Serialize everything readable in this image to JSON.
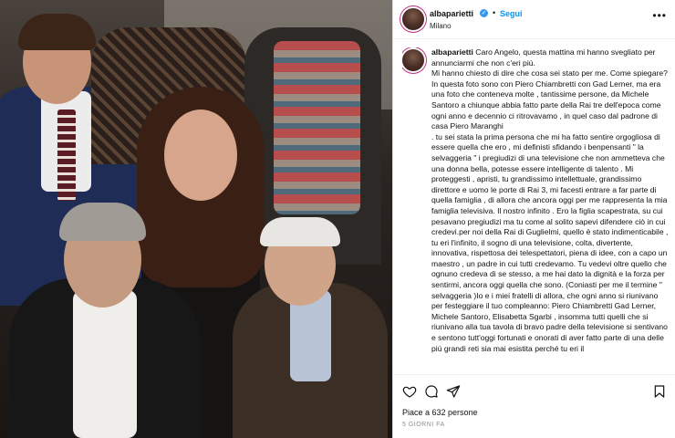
{
  "post": {
    "username": "albaparietti",
    "verified_icon": "✓",
    "dot": "•",
    "follow_label": "Segui",
    "location": "Milano",
    "more_icon": "•••"
  },
  "caption": {
    "username": "albaparietti",
    "text": " Caro Angelo, questa mattina mi hanno svegliato per annunciarmi che non c'eri più.\nMi hanno chiesto di dire che cosa sei stato per me. Come spiegare?\nIn questa foto sono con Piero Chiambretti con Gad Lerner, ma era una foto che conteneva molte , tantissime persone, da Michele Santoro a chiunque abbia fatto parte della Rai tre dell'epoca come ogni anno e decennio ci ritrovavamo , in quel caso dal padrone di casa Piero Maranghi\n. tu sei stata la prima persona che mi ha fatto sentire orgogliosa di essere quella che ero , mi definisti sfidando i benpensanti \" la selvaggeria \" i pregiudizi di una televisione che non ammetteva che una donna bella, potesse essere intelligente di talento . Mi proteggesti , apristi, tu grandissimo intellettuale, grandissimo direttore e uomo le porte di Rai 3, mi facesti entrare a far parte di quella famiglia , di allora che ancora oggi per me rappresenta la mia famiglia televisiva. Il nostro infinito . Ero la figlia scapestrata, su cui pesavano pregiudizi ma tu come al solito sapevi difendere ciò in cui credevi.per noi della Rai di Guglielmi, quello è stato indimenticabile , tu eri l'infinito, il sogno di una televisione, colta, divertente, innovativa, rispettosa dei telespettatori, piena di idee, con a capo un maestro , un padre in cui tutti credevamo. Tu vedevi oltre quello che ognuno credeva di se stesso, a me hai dato la dignità e la forza per sentirmi, ancora oggi quella che sono. (Coniasti per me il termine \" selvaggeria )Io e i miei fratelli di allora, che ogni anno si riunivano per festeggiare il tuo compleanno: Piero Chiambretti Gad Lerner, Michele Santoro, Elisabetta Sgarbi , insomma tutti quelli che si riunivano alla tua tavola di bravo padre della televisione si sentivano e sentono tutt'oggi fortunati e onorati di aver fatto parte di una delle più grandi reti sia mai esistita perché tu eri il"
  },
  "footer": {
    "likes": "Piace a 632 persone",
    "time": "5 GIORNI FA"
  },
  "icons": [
    "heart-icon",
    "comment-icon",
    "share-icon",
    "bookmark-icon"
  ]
}
